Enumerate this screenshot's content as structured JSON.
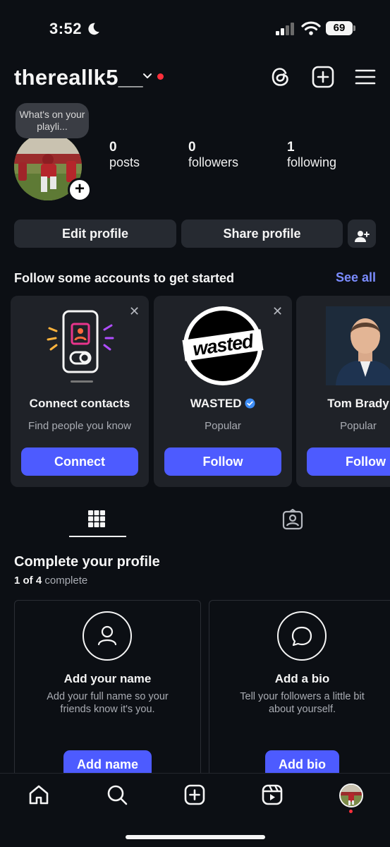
{
  "status": {
    "time": "3:52",
    "battery": "69"
  },
  "header": {
    "username": "thereallk5__"
  },
  "profile": {
    "note": "What's on your playli...",
    "posts_count": "0",
    "posts_label": "posts",
    "followers_count": "0",
    "followers_label": "followers",
    "following_count": "1",
    "following_label": "following"
  },
  "actions": {
    "edit": "Edit profile",
    "share": "Share profile"
  },
  "suggestions": {
    "title": "Follow some accounts to get started",
    "see_all": "See all",
    "cards": [
      {
        "name": "Connect contacts",
        "subtitle": "Find people you know",
        "button": "Connect",
        "close": "✕"
      },
      {
        "name": "WASTED",
        "subtitle": "Popular",
        "button": "Follow",
        "close": "✕",
        "logo_text": "wasted"
      },
      {
        "name": "Tom Brady",
        "subtitle": "Popular",
        "button": "Follow"
      }
    ]
  },
  "complete_profile": {
    "title": "Complete your profile",
    "progress_count": "1 of 4",
    "progress_word": "complete",
    "cards": [
      {
        "title": "Add your name",
        "desc_line1": "Add your full name so your",
        "desc_line2": "friends know it's you.",
        "button": "Add name"
      },
      {
        "title": "Add a bio",
        "desc_line1": "Tell your followers a little bit",
        "desc_line2": "about yourself.",
        "button": "Add bio"
      }
    ]
  },
  "colors": {
    "background": "#0c0f14",
    "accent": "#4d5bff",
    "link": "#7b8cff",
    "notification": "#ff2f3b",
    "verified": "#3e8ef7"
  }
}
